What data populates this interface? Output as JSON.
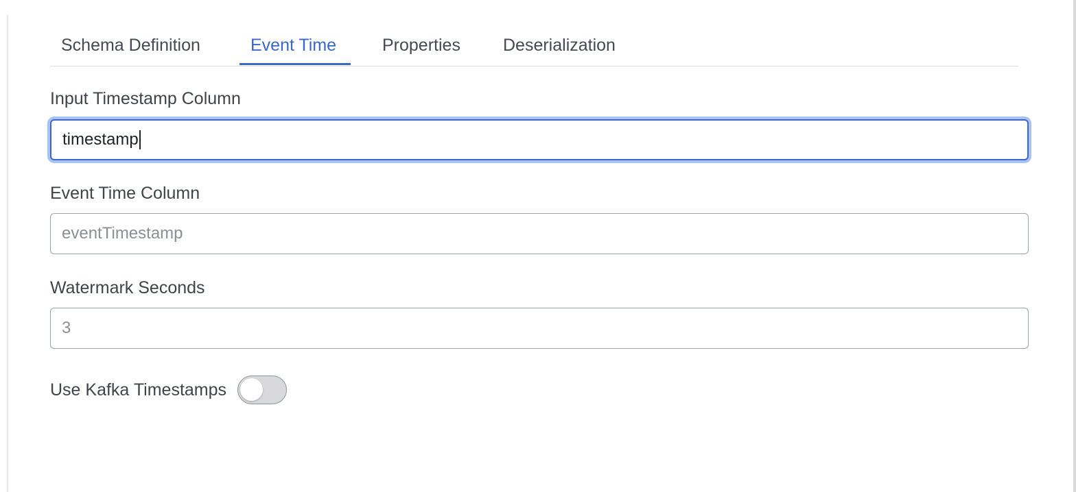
{
  "tabs": [
    {
      "label": "Schema Definition",
      "active": false
    },
    {
      "label": "Event Time",
      "active": true
    },
    {
      "label": "Properties",
      "active": false
    },
    {
      "label": "Deserialization",
      "active": false
    }
  ],
  "form": {
    "input_timestamp": {
      "label": "Input Timestamp Column",
      "value": "timestamp"
    },
    "event_time": {
      "label": "Event Time Column",
      "placeholder": "eventTimestamp"
    },
    "watermark": {
      "label": "Watermark Seconds",
      "placeholder": "3"
    },
    "kafka_toggle": {
      "label": "Use Kafka Timestamps",
      "checked": false
    }
  },
  "colors": {
    "accent": "#3a67c9",
    "focus_ring": "#a9c3f0",
    "text": "#3f4449",
    "placeholder": "#8a8f94",
    "toggle_off": "#d9d9dc"
  }
}
